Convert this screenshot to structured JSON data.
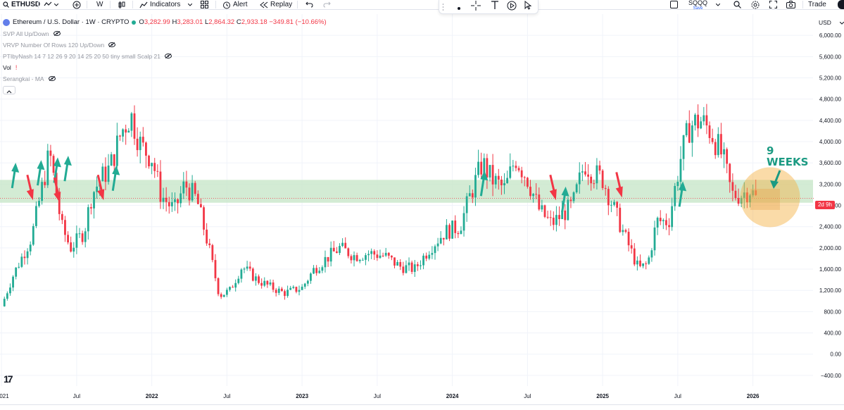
{
  "toolbar": {
    "symbol": "ETHUSD",
    "interval": "W",
    "indicators_label": "Indicators",
    "alert_label": "Alert",
    "replay_label": "Replay",
    "layout_name": "SQQQ",
    "save_label": "Save",
    "trade_label": "Trade"
  },
  "legend": {
    "title": "Ethereum / U.S. Dollar · 1W · CRYPTO",
    "open_key": "O",
    "open": "3,282.99",
    "high_key": "H",
    "high": "3,283.01",
    "low_key": "L",
    "low": "2,864.32",
    "close_key": "C",
    "close": "2,933.18",
    "change": "−349.81 (−10.66%)"
  },
  "indicators": [
    {
      "label": "SVP All Up/Down"
    },
    {
      "label": "VRVP Number Of Rows 120 Up/Down"
    },
    {
      "label": "PTIbyNash 14 7 12 26 9 20 14 25 20 50 tiny small Scalp 21"
    },
    {
      "label": "Vol"
    },
    {
      "label": "Serangkai - MA"
    }
  ],
  "currency": "USD",
  "last_price_label": "2d 9h",
  "annotation_text_line1": "9",
  "annotation_text_line2": "WEEKS",
  "colors": {
    "up": "#22ab94",
    "down": "#f23645",
    "zone": "#c8e6c9",
    "circle": "#f5b041"
  },
  "chart_data": {
    "type": "candlestick",
    "y_ticks": [
      "6,000.00",
      "5,600.00",
      "5,200.00",
      "4,800.00",
      "4,400.00",
      "4,000.00",
      "3,600.00",
      "3,200.00",
      "2,800.00",
      "2,400.00",
      "2,000.00",
      "1,600.00",
      "1,200.00",
      "800.00",
      "400.00",
      "0.00",
      "−400.00"
    ],
    "x_ticks": [
      "021",
      "Jul",
      "2022",
      "Jul",
      "2023",
      "Jul",
      "2024",
      "Jul",
      "2025",
      "Jul",
      "2026"
    ],
    "ylim": [
      -600,
      6400
    ],
    "zone": [
      2850,
      3280
    ],
    "current_price": 2933.18,
    "close_path": [
      [
        2021.0,
        900
      ],
      [
        2021.08,
        1500
      ],
      [
        2021.2,
        2200
      ],
      [
        2021.32,
        3800
      ],
      [
        2021.4,
        2400
      ],
      [
        2021.46,
        2000
      ],
      [
        2021.55,
        2300
      ],
      [
        2021.6,
        3000
      ],
      [
        2021.66,
        3300
      ],
      [
        2021.72,
        3500
      ],
      [
        2021.8,
        4200
      ],
      [
        2021.86,
        4500
      ],
      [
        2021.93,
        3900
      ],
      [
        2022.0,
        3700
      ],
      [
        2022.06,
        3000
      ],
      [
        2022.15,
        2700
      ],
      [
        2022.22,
        3200
      ],
      [
        2022.3,
        2900
      ],
      [
        2022.38,
        2000
      ],
      [
        2022.45,
        1100
      ],
      [
        2022.52,
        1200
      ],
      [
        2022.6,
        1650
      ],
      [
        2022.7,
        1400
      ],
      [
        2022.8,
        1250
      ],
      [
        2022.88,
        1150
      ],
      [
        2023.0,
        1250
      ],
      [
        2023.08,
        1600
      ],
      [
        2023.16,
        1800
      ],
      [
        2023.25,
        2000
      ],
      [
        2023.35,
        1850
      ],
      [
        2023.45,
        1900
      ],
      [
        2023.55,
        1850
      ],
      [
        2023.65,
        1650
      ],
      [
        2023.75,
        1600
      ],
      [
        2023.85,
        2000
      ],
      [
        2023.95,
        2300
      ],
      [
        2024.05,
        2400
      ],
      [
        2024.12,
        3000
      ],
      [
        2024.2,
        3600
      ],
      [
        2024.26,
        3300
      ],
      [
        2024.35,
        3100
      ],
      [
        2024.42,
        3700
      ],
      [
        2024.5,
        3300
      ],
      [
        2024.58,
        2700
      ],
      [
        2024.66,
        2450
      ],
      [
        2024.72,
        2600
      ],
      [
        2024.8,
        2800
      ],
      [
        2024.88,
        3600
      ],
      [
        2024.94,
        3400
      ],
      [
        2025.0,
        3300
      ],
      [
        2025.08,
        2700
      ],
      [
        2025.15,
        2200
      ],
      [
        2025.24,
        1600
      ],
      [
        2025.3,
        1700
      ],
      [
        2025.36,
        2500
      ],
      [
        2025.44,
        2500
      ],
      [
        2025.52,
        3700
      ],
      [
        2025.58,
        4300
      ],
      [
        2025.65,
        4400
      ],
      [
        2025.72,
        4200
      ],
      [
        2025.8,
        3700
      ],
      [
        2025.86,
        3000
      ],
      [
        2025.92,
        3000
      ],
      [
        2025.98,
        3100
      ],
      [
        2026.02,
        2933
      ]
    ],
    "up_arrows": [
      [
        2021.08,
        3550
      ],
      [
        2021.25,
        3600
      ],
      [
        2021.36,
        3650
      ],
      [
        2021.43,
        3680
      ],
      [
        2021.75,
        3500
      ],
      [
        2024.2,
        3400
      ],
      [
        2024.74,
        3100
      ],
      [
        2025.52,
        3200
      ]
    ],
    "down_arrows": [
      [
        2021.2,
        2950
      ],
      [
        2021.38,
        2900
      ],
      [
        2021.67,
        2950
      ],
      [
        2024.68,
        2950
      ],
      [
        2025.12,
        3000
      ]
    ]
  }
}
